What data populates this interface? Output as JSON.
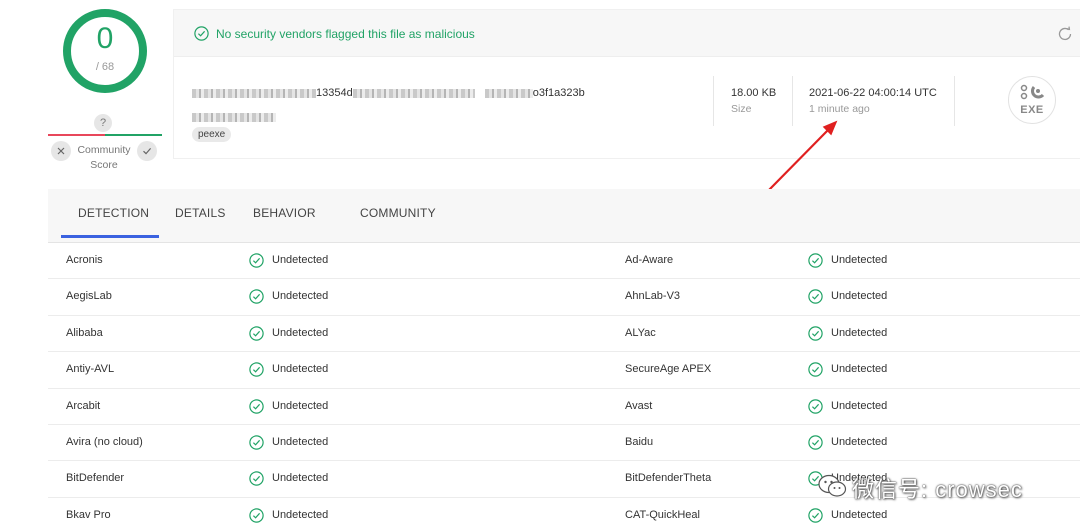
{
  "score": {
    "detections": "0",
    "total": "/ 68",
    "unknown_badge": "?",
    "community_label": "Community Score"
  },
  "summary": {
    "banner_text": "No security vendors flagged this file as malicious",
    "hash_visible_mid": "13354d",
    "hash_visible_end": "o3f1a323b",
    "tag": "peexe",
    "size_value": "18.00 KB",
    "size_label": "Size",
    "date_value": "2021-06-22 04:00:14 UTC",
    "date_relative": "1 minute ago",
    "file_type": "EXE"
  },
  "tabs": [
    {
      "label": "DETECTION",
      "active": true
    },
    {
      "label": "DETAILS",
      "active": false
    },
    {
      "label": "BEHAVIOR",
      "active": false
    },
    {
      "label": "COMMUNITY",
      "active": false
    }
  ],
  "detections": [
    {
      "left_vendor": "Acronis",
      "left_result": "Undetected",
      "right_vendor": "Ad-Aware",
      "right_result": "Undetected"
    },
    {
      "left_vendor": "AegisLab",
      "left_result": "Undetected",
      "right_vendor": "AhnLab-V3",
      "right_result": "Undetected"
    },
    {
      "left_vendor": "Alibaba",
      "left_result": "Undetected",
      "right_vendor": "ALYac",
      "right_result": "Undetected"
    },
    {
      "left_vendor": "Antiy-AVL",
      "left_result": "Undetected",
      "right_vendor": "SecureAge APEX",
      "right_result": "Undetected"
    },
    {
      "left_vendor": "Arcabit",
      "left_result": "Undetected",
      "right_vendor": "Avast",
      "right_result": "Undetected"
    },
    {
      "left_vendor": "Avira (no cloud)",
      "left_result": "Undetected",
      "right_vendor": "Baidu",
      "right_result": "Undetected"
    },
    {
      "left_vendor": "BitDefender",
      "left_result": "Undetected",
      "right_vendor": "BitDefenderTheta",
      "right_result": "Undetected"
    },
    {
      "left_vendor": "Bkav Pro",
      "left_result": "Undetected",
      "right_vendor": "CAT-QuickHeal",
      "right_result": "Undetected"
    }
  ],
  "watermark": "微信号: crowsec",
  "colors": {
    "clean_green": "#21a366",
    "malicious_red": "#e8475b",
    "tab_accent": "#3b62e0",
    "annotation_red": "#e02020"
  }
}
